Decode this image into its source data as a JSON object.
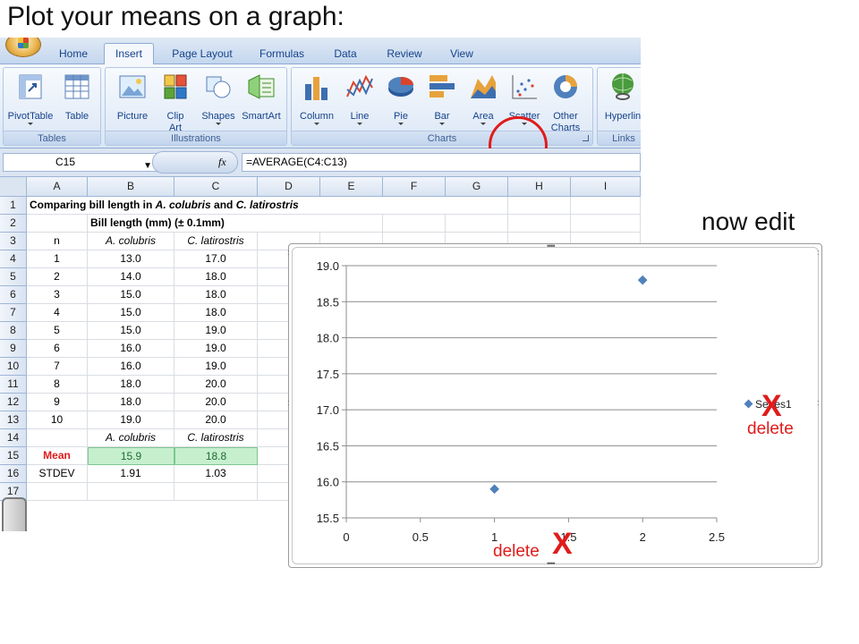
{
  "slide": {
    "title": "Plot your means on a graph:",
    "note": "now edit"
  },
  "ribbon": {
    "tabs": [
      "Home",
      "Insert",
      "Page Layout",
      "Formulas",
      "Data",
      "Review",
      "View"
    ],
    "active_tab": "Insert",
    "groups": {
      "tables": {
        "label": "Tables",
        "buttons": [
          "PivotTable",
          "Table"
        ]
      },
      "illustrations": {
        "label": "Illustrations",
        "buttons": [
          "Picture",
          "Clip\nArt",
          "Shapes",
          "SmartArt"
        ]
      },
      "charts": {
        "label": "Charts",
        "buttons": [
          "Column",
          "Line",
          "Pie",
          "Bar",
          "Area",
          "Scatter",
          "Other\nCharts"
        ]
      },
      "links": {
        "label": "Links",
        "buttons": [
          "Hyperlin"
        ]
      }
    },
    "highlighted_button": "Scatter"
  },
  "formula_bar": {
    "name_box": "C15",
    "fx": "fx",
    "formula": "=AVERAGE(C4:C13)"
  },
  "sheet": {
    "columns": [
      "A",
      "B",
      "C",
      "D",
      "E",
      "F",
      "G",
      "H",
      "I"
    ],
    "rows": [
      "1",
      "2",
      "3",
      "4",
      "5",
      "6",
      "7",
      "8",
      "9",
      "10",
      "11",
      "12",
      "13",
      "14",
      "15",
      "16",
      "17"
    ],
    "title_row": {
      "prefix": "Comparing bill length in ",
      "species_a": "A. colubris",
      "connector": " and ",
      "species_b": "C. latirostris"
    },
    "subheader": "Bill length (mm) (± 0.1mm)",
    "header": [
      "n",
      "A. colubris",
      "C. latirostris"
    ],
    "data": [
      [
        "1",
        "13.0",
        "17.0"
      ],
      [
        "2",
        "14.0",
        "18.0"
      ],
      [
        "3",
        "15.0",
        "18.0"
      ],
      [
        "4",
        "15.0",
        "18.0"
      ],
      [
        "5",
        "15.0",
        "19.0"
      ],
      [
        "6",
        "16.0",
        "19.0"
      ],
      [
        "7",
        "16.0",
        "19.0"
      ],
      [
        "8",
        "18.0",
        "20.0"
      ],
      [
        "9",
        "18.0",
        "20.0"
      ],
      [
        "10",
        "19.0",
        "20.0"
      ]
    ],
    "visible_rows_for_data": [
      "4",
      "5",
      "6",
      "7",
      "8",
      "9",
      "10",
      "11",
      "12",
      "13"
    ],
    "row14": [
      "",
      "A. colubris",
      "C. latirostris"
    ],
    "mean": {
      "label": "Mean",
      "a": "15.9",
      "c": "18.8"
    },
    "stdev": {
      "label": "STDEV",
      "a": "1.91",
      "c": "1.03"
    }
  },
  "chart_data": {
    "type": "scatter",
    "series": [
      {
        "name": "Series1",
        "x": [
          1,
          2
        ],
        "y": [
          15.9,
          18.8
        ],
        "color": "#4f81bd"
      }
    ],
    "xlim": [
      0,
      2.5
    ],
    "ylim": [
      15.5,
      19.0
    ],
    "x_ticks": [
      "0",
      "0.5",
      "1",
      "1.5",
      "2",
      "2.5"
    ],
    "y_ticks": [
      "15.5",
      "16.0",
      "16.5",
      "17.0",
      "17.5",
      "18.0",
      "18.5",
      "19.0"
    ],
    "grid": "horizontal",
    "legend_position": "right"
  },
  "annotations": {
    "delete_label": "delete",
    "x_mark": "X"
  }
}
